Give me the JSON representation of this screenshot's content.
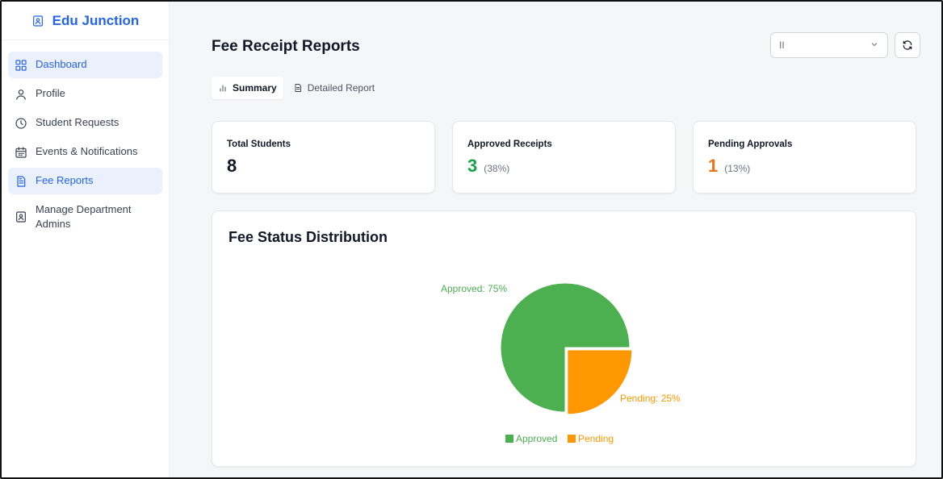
{
  "app": {
    "name": "Edu Junction"
  },
  "sidebar": {
    "items": [
      {
        "label": "Dashboard",
        "icon": "dashboard-icon",
        "active": true
      },
      {
        "label": "Profile",
        "icon": "user-icon",
        "active": false
      },
      {
        "label": "Student Requests",
        "icon": "clock-icon",
        "active": false
      },
      {
        "label": "Events & Notifications",
        "icon": "calendar-icon",
        "active": false
      },
      {
        "label": "Fee Reports",
        "icon": "document-icon",
        "active": true
      },
      {
        "label": "Manage Department Admins",
        "icon": "id-badge-icon",
        "active": false
      }
    ]
  },
  "header": {
    "title": "Fee Receipt Reports",
    "select_value": "II",
    "refresh_icon": "refresh-icon"
  },
  "tabs": [
    {
      "label": "Summary",
      "icon": "bar-chart-icon",
      "active": true
    },
    {
      "label": "Detailed Report",
      "icon": "document-icon",
      "active": false
    }
  ],
  "stats": [
    {
      "title": "Total Students",
      "value": "8",
      "percent": "",
      "color": "#111827"
    },
    {
      "title": "Approved Receipts",
      "value": "3",
      "percent": "(38%)",
      "color": "#16a34a"
    },
    {
      "title": "Pending Approvals",
      "value": "1",
      "percent": "(13%)",
      "color": "#ea7317"
    }
  ],
  "chart": {
    "title": "Fee Status Distribution"
  },
  "chart_data": {
    "type": "pie",
    "title": "Fee Status Distribution",
    "categories": [
      "Approved",
      "Pending"
    ],
    "values": [
      75,
      25
    ],
    "colors": [
      "#4caf50",
      "#ff9800"
    ],
    "slice_labels": [
      "Approved: 75%",
      "Pending: 25%"
    ],
    "legend": [
      "Approved",
      "Pending"
    ],
    "legend_position": "bottom"
  }
}
